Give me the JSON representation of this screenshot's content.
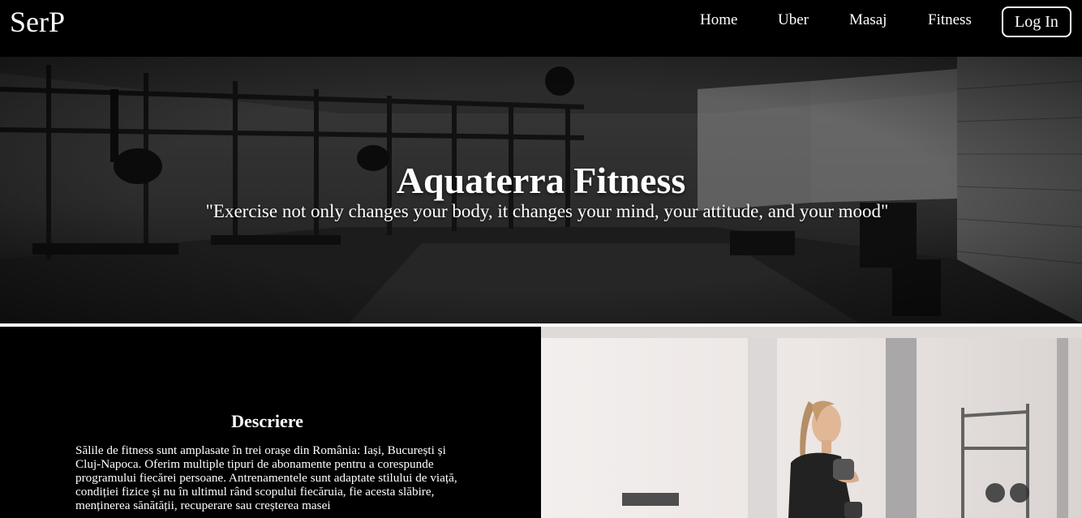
{
  "nav": {
    "brand": "SerP",
    "links": [
      {
        "label": "Home"
      },
      {
        "label": "Uber"
      },
      {
        "label": "Masaj"
      },
      {
        "label": "Fitness"
      }
    ],
    "login_label": "Log In"
  },
  "hero": {
    "title": "Aquaterra Fitness",
    "quote": "\"Exercise not only changes your body, it changes your mind, your attitude, and your mood\""
  },
  "description": {
    "title": "Descriere",
    "text": "Sălile de fitness sunt amplasate în trei orașe din România: Iași, București și Cluj-Napoca. Oferim multiple tipuri de abonamente pentru a corespunde programului fiecărei persoane. Antrenamentele sunt adaptate stilului de viață, condiției fizice și nu în ultimul rând scopului fiecăruia, fie acesta slăbire, menținerea sănătății, recuperare sau creșterea masei"
  },
  "colors": {
    "background": "#000000",
    "text": "#ffffff"
  }
}
